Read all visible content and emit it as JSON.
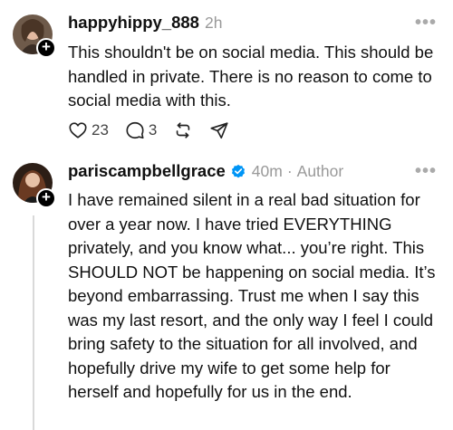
{
  "posts": [
    {
      "username": "happyhippy_888",
      "time": "2h",
      "more": "•••",
      "follow": "+",
      "text": "This shouldn't be on social media. This should be handled in private. There is no reason to come to social media with this.",
      "likes": "23",
      "replies": "3"
    },
    {
      "username": "pariscampbellgrace",
      "verified": true,
      "time": "40m",
      "separator": "·",
      "role": "Author",
      "more": "•••",
      "follow": "+",
      "text": "I have remained silent in a real bad situation for over a year now. I have tried EVERYTHING privately, and you know what... you’re right. This SHOULD NOT be happening on social media. It’s beyond embarrassing. Trust me when I say this was my last resort, and the only way I feel I could bring safety to the situation for all involved, and hopefully drive my wife to get some help for herself and hopefully for us in the end."
    }
  ],
  "icons": {
    "like": "heart-icon",
    "reply": "comment-icon",
    "repost": "repost-icon",
    "share": "send-icon",
    "verified": "verified-badge-icon"
  },
  "colors": {
    "text": "#101010",
    "muted": "#999999",
    "verified": "#0095f6"
  }
}
